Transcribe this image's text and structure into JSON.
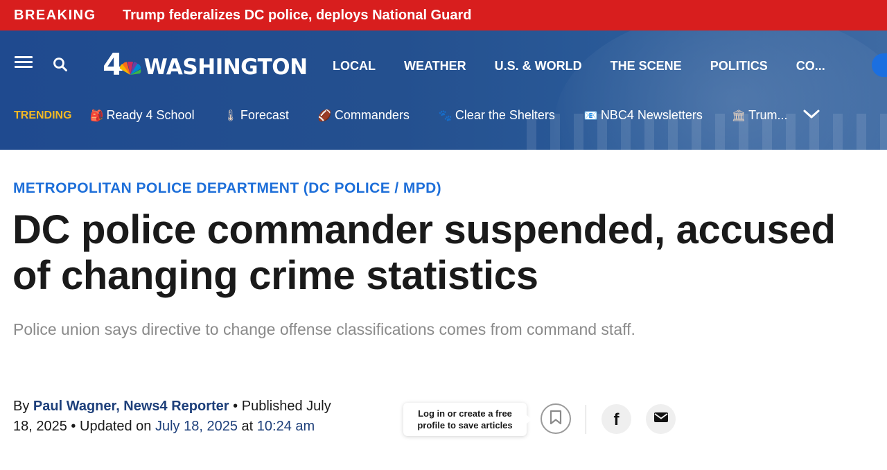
{
  "breaking": {
    "tag": "BREAKING",
    "headline": "Trump federalizes DC police, deploys National Guard",
    "color": "#d81e1e"
  },
  "header": {
    "logo": {
      "number": "4",
      "wordmark": "WASHINGTON",
      "icon": "nbc-peacock-icon"
    },
    "nav": [
      "LOCAL",
      "WEATHER",
      "U.S. & WORLD",
      "THE SCENE",
      "POLITICS",
      "CO..."
    ],
    "trending": {
      "label": "TRENDING",
      "items": [
        {
          "icon": "🎒",
          "label": "Ready 4 School"
        },
        {
          "icon": "🌡",
          "label": "Forecast"
        },
        {
          "icon": "🏈",
          "label": "Commanders"
        },
        {
          "icon": "🐾",
          "label": "Clear the Shelters"
        },
        {
          "icon": "📧",
          "label": "NBC4 Newsletters"
        },
        {
          "icon": "🏛",
          "label": "Trum..."
        }
      ]
    },
    "accent": "#f2b824",
    "background": "#24508f"
  },
  "article": {
    "kicker": "METROPOLITAN POLICE DEPARTMENT (DC POLICE / MPD)",
    "title": "DC police commander suspended, accused of changing crime statistics",
    "dek": "Police union says directive to change offense classifications comes from command staff.",
    "byline": {
      "by": "By",
      "author": "Paul Wagner, News4 Reporter",
      "sep1": "•",
      "published_label": "Published",
      "published_date": "July 18, 2025",
      "sep2": "•",
      "updated_label": "Updated on",
      "updated_date": "July 18, 2025",
      "at": "at",
      "updated_time": "10:24 am"
    },
    "save_tooltip": "Log in or create a free profile to save articles",
    "kicker_color": "#1e6fd9"
  }
}
